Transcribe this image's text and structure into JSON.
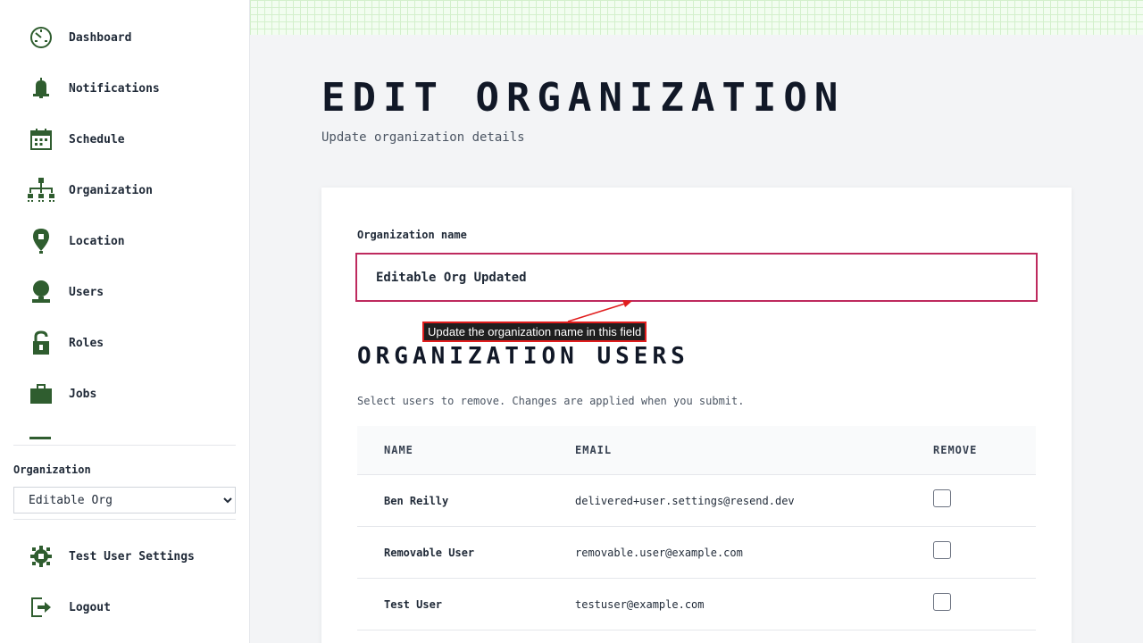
{
  "sidebar": {
    "items": [
      {
        "label": "Dashboard",
        "icon": "dashboard-icon"
      },
      {
        "label": "Notifications",
        "icon": "bell-icon"
      },
      {
        "label": "Schedule",
        "icon": "calendar-icon"
      },
      {
        "label": "Organization",
        "icon": "org-chart-icon"
      },
      {
        "label": "Location",
        "icon": "location-pin-icon"
      },
      {
        "label": "Users",
        "icon": "user-icon"
      },
      {
        "label": "Roles",
        "icon": "unlock-icon"
      },
      {
        "label": "Jobs",
        "icon": "briefcase-icon"
      }
    ],
    "org_label": "Organization",
    "org_selected": "Editable Org",
    "bottom_items": [
      {
        "label": "Test User Settings",
        "icon": "gear-icon"
      },
      {
        "label": "Logout",
        "icon": "logout-icon"
      }
    ]
  },
  "main": {
    "title": "Edit Organization",
    "subtitle": "Update organization details",
    "form": {
      "name_label": "Organization name",
      "name_value": "Editable Org Updated"
    },
    "users_section": {
      "title": "Organization Users",
      "description": "Select users to remove. Changes are applied when you submit.",
      "headers": {
        "name": "NAME",
        "email": "EMAIL",
        "remove": "REMOVE"
      },
      "rows": [
        {
          "name": "Ben Reilly",
          "email": "delivered+user.settings@resend.dev"
        },
        {
          "name": "Removable User",
          "email": "removable.user@example.com"
        },
        {
          "name": "Test User",
          "email": "testuser@example.com"
        }
      ]
    }
  },
  "annotation": {
    "text": "Update the organization name in this field"
  },
  "colors": {
    "icon_green": "#2f5d2f",
    "accent_border": "#be2a5e",
    "annotation_red": "#e11d1d"
  }
}
